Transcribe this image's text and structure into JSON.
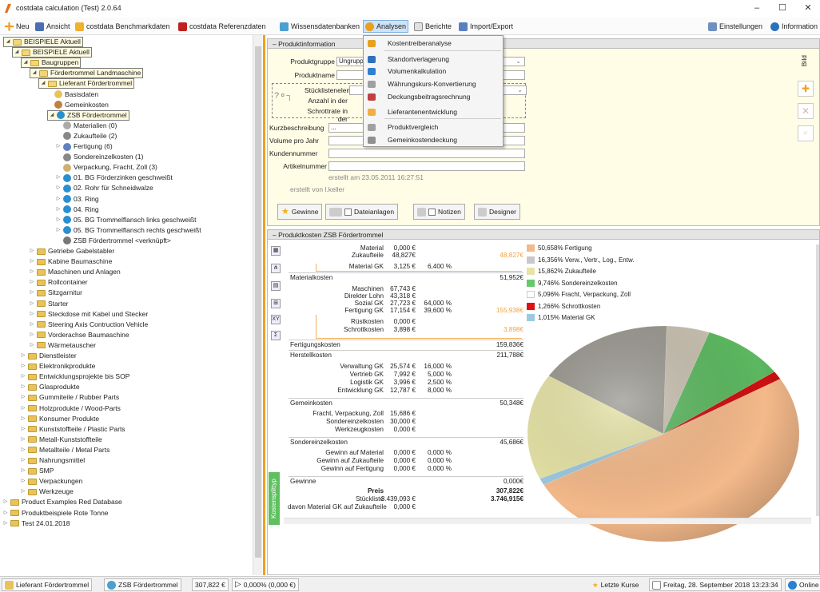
{
  "window": {
    "title": "costdata calculation (Test) 2.0.64",
    "minimize": "–",
    "maximize": "☐",
    "close": "✕"
  },
  "menu": {
    "new": "Neu",
    "view": "Ansicht",
    "benchmark": "costdata Benchmarkdaten",
    "reference": "costdata Referenzdaten",
    "knowledge": "Wissensdatenbanken",
    "analyses": "Analysen",
    "reports": "Berichte",
    "import_export": "Import/Export",
    "settings": "Einstellungen",
    "information": "Information"
  },
  "dropdown": {
    "items": [
      "Kostentreiberanalyse",
      "Standortverlagerung",
      "Volumenkalkulation",
      "Währungskurs-Konvertierung",
      "Deckungsbeitragsrechnung",
      "Lieferantenentwicklung",
      "Produktvergleich",
      "Gemeinkostendeckung"
    ]
  },
  "tree": {
    "rows": [
      "BEISPIELE Aktuell",
      "BEISPIELE Aktuell",
      "Baugruppen",
      "Fördertrommel Landmaschine",
      "Lieferant Fördertrommel",
      "Basisdaten",
      "Gemeinkosten",
      "ZSB Fördertrommel",
      "Materialien (0)",
      "Zukaufteile (2)",
      "Fertigung (6)",
      "Sondereinzelkosten (1)",
      "Verpackung, Fracht, Zoll (3)",
      "01. BG Förderzinken geschweißt",
      "02. Rohr für Schneidwalze",
      "03. Ring",
      "04. Ring",
      "05. BG Trommelflansch links geschweißt",
      "05. BG Trommelflansch rechts geschweißt",
      "ZSB Fördertrommel <verknüpft>",
      "Getriebe Gabelstabler",
      "Kabine Baumaschine",
      "Maschinen und Anlagen",
      "Rollcontainer",
      "Sitzgarnitur",
      "Starter",
      "Steckdose mit Kabel und Stecker",
      "Steering Axis Contruction Vehicle",
      "Vorderachse Baumaschine",
      "Wärmetauscher",
      "Dienstleister",
      "Elektronikprodukte",
      "Entwicklungsprojekte bis SOP",
      "Glasprodukte",
      "Gummiteile / Rubber Parts",
      "Holzprodukte / Wood-Parts",
      "Konsumer Produkte",
      "Kunststoffteile / Plastic Parts",
      "Metall-Kunststoffteile",
      "Metallteile / Metal Parts",
      "Nahrungsmittel",
      "SMP",
      "Verpackungen",
      "Werkzeuge",
      "Product Examples Red Database",
      "Produktbeispiele Rote Tonne",
      "Test 24.01.2018"
    ]
  },
  "info": {
    "header": "Produktinformation",
    "produktgruppe_label": "Produktgruppe",
    "produktgruppe_value": "Ungruppier",
    "produktname_label": "Produktname",
    "stueckliste_label": "Stücklistenelemen",
    "anzahl_label": "Anzahl in der",
    "schrott_label": "Schrottrate in der",
    "kurzbeschreibung_label": "Kurzbeschreibung",
    "kurzbeschreibung_value": "...",
    "volumen_label": "Volume pro Jahr",
    "kunden_label": "Kundennummer",
    "artikel_label": "Artikelnummer",
    "erstellt_am": "erstellt am 23.05.2011 16:27:51",
    "erstellt_von": "erstellt von l.keller",
    "btn_gewinne": "Gewinne",
    "btn_dateianlagen": "Dateianlagen",
    "btn_notizen": "Notizen",
    "btn_designer": "Designer",
    "bild_label": "Bild"
  },
  "cost": {
    "header": "Produktkosten ZSB Fördertrommel",
    "side_tab": "Kostensplittyp",
    "rows": {
      "material": [
        "Material",
        "0,000 €"
      ],
      "zukaufteile": [
        "Zukaufteile",
        "48,827€",
        "48,827€"
      ],
      "material_gk": [
        "Material GK",
        "3,125 €",
        "6,400 %"
      ],
      "materialkosten": [
        "Materialkosten",
        "51,952€"
      ],
      "maschinen": [
        "Maschinen",
        "67,743 €"
      ],
      "direkter_lohn": [
        "Direkter Lohn",
        "43,318 €"
      ],
      "sozial_gk": [
        "Sozial GK",
        "27,723 €",
        "64,000 %"
      ],
      "fertigung_gk": [
        "Fertigung GK",
        "17,154 €",
        "39,600 %",
        "155,938€"
      ],
      "ruestkosten": [
        "Rüstkosten",
        "0,000 €"
      ],
      "schrottkosten": [
        "Schrottkosten",
        "3,898 €",
        "3,898€"
      ],
      "fertigungskosten": [
        "Fertigungskosten",
        "159,836€"
      ],
      "herstellkosten": [
        "Herstellkosten",
        "211,788€"
      ],
      "verwaltung_gk": [
        "Verwaltung GK",
        "25,574 €",
        "16,000 %"
      ],
      "vertrieb_gk": [
        "Vertrieb GK",
        "7,992 €",
        "5,000 %"
      ],
      "logistik_gk": [
        "Logistik GK",
        "3,996 €",
        "2,500 %"
      ],
      "entwicklung_gk": [
        "Entwicklung GK",
        "12,787 €",
        "8,000 %"
      ],
      "gemeinkosten": [
        "Gemeinkosten",
        "50,348€"
      ],
      "fracht": [
        "Fracht, Verpackung, Zoll",
        "15,686 €"
      ],
      "sondereinzelkosten_v": [
        "Sondereinzelkosten",
        "30,000 €"
      ],
      "werkzeugkosten": [
        "Werkzeugkosten",
        "0,000 €"
      ],
      "sondereinzelkosten": [
        "Sondereinzelkosten",
        "45,686€"
      ],
      "gewinn_material": [
        "Gewinn auf Material",
        "0,000 €",
        "0,000 %"
      ],
      "gewinn_zukauf": [
        "Gewinn auf Zukaufteile",
        "0,000 €",
        "0,000 %"
      ],
      "gewinn_fertigung": [
        "Gewinn auf Fertigung",
        "0,000 €",
        "0,000 %"
      ],
      "gewinne": [
        "Gewinne",
        "0,000€"
      ],
      "preis": [
        "Preis",
        "307,822€"
      ],
      "stueckliste": [
        "Stückliste",
        "3.439,093 €",
        "3.746,915€"
      ],
      "davon": [
        "davon Material GK auf Zukaufteile",
        "0,000 €"
      ]
    },
    "legend": [
      {
        "label": "50,658% Fertigung",
        "color": "#f4b98a"
      },
      {
        "label": "16,356% Verw., Vertr., Log., Entw.",
        "color": "#c8c8c8"
      },
      {
        "label": "15,862% Zukaufteile",
        "color": "#e6e3a6"
      },
      {
        "label": "9,746% Sondereinzelkosten",
        "color": "#68c86c"
      },
      {
        "label": "5,096% Fracht, Verpackung, Zoll",
        "color": "#ffffff"
      },
      {
        "label": "1,266% Schrottkosten",
        "color": "#dd1111"
      },
      {
        "label": "1,015% Material GK",
        "color": "#9cc9e0"
      }
    ]
  },
  "chart_data": {
    "type": "pie",
    "categories": [
      "Fertigung",
      "Verw., Vertr., Log., Entw.",
      "Zukaufteile",
      "Sondereinzelkosten",
      "Fracht, Verpackung, Zoll",
      "Schrottkosten",
      "Material GK"
    ],
    "values": [
      50.658,
      16.356,
      15.862,
      9.746,
      5.096,
      1.266,
      1.015
    ],
    "colors": [
      "#f4b98a",
      "#9a9890",
      "#e6e3a6",
      "#5cb860",
      "#c8c0b0",
      "#cc1111",
      "#9cc9e0"
    ]
  },
  "status": {
    "item1": "Lieferant Fördertrommel",
    "item2": "ZSB Fördertrommel",
    "price": "307,822 €",
    "delta": "0,000% (0,000 €)",
    "letzte_kurse": "Letzte Kurse",
    "datetime": "Freitag, 28. September 2018 13:23:34",
    "online": "Online"
  }
}
